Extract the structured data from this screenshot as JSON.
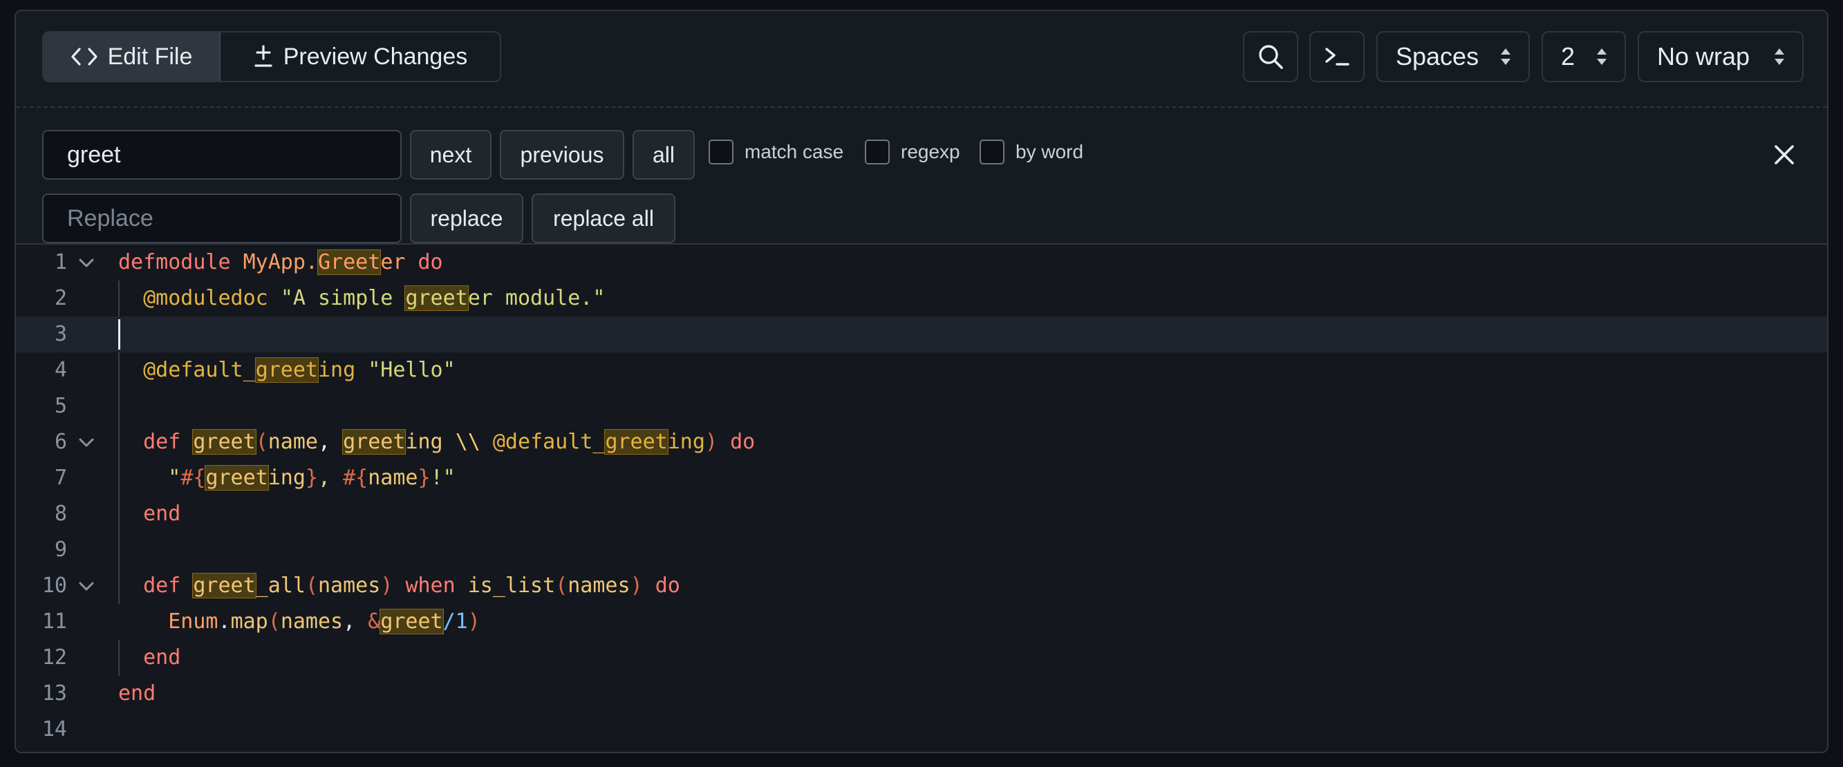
{
  "toolbar": {
    "edit_file_label": "Edit File",
    "preview_changes_label": "Preview Changes",
    "indent_mode": "Spaces",
    "indent_size": "2",
    "wrap_mode": "No wrap"
  },
  "find": {
    "search_value": "greet",
    "replace_placeholder": "Replace",
    "next_label": "next",
    "previous_label": "previous",
    "all_label": "all",
    "match_case_label": "match case",
    "regexp_label": "regexp",
    "by_word_label": "by word",
    "replace_label": "replace",
    "replace_all_label": "replace all"
  },
  "colors": {
    "background": "#0d1117",
    "panel": "#161b22",
    "keyword": "#ff7b72",
    "string": "#d6d87a",
    "match_highlight": "#4a3c13"
  },
  "editor": {
    "line_numbers": [
      "1",
      "2",
      "3",
      "4",
      "5",
      "6",
      "7",
      "8",
      "9",
      "10",
      "11",
      "12",
      "13",
      "14"
    ],
    "lines": [
      "defmodule MyApp.Greeter do",
      "  @moduledoc \"A simple greeter module.\"",
      "",
      "  @default_greeting \"Hello\"",
      "",
      "  def greet(name, greeting \\\\ @default_greeting) do",
      "    \"#{greeting}, #{name}!\"",
      "  end",
      "",
      "  def greet_all(names) when is_list(names) do",
      "    Enum.map(names, &greet/1)",
      "  end",
      "end",
      ""
    ],
    "active_line": 3,
    "folded_lines": [
      1,
      6,
      10
    ]
  }
}
